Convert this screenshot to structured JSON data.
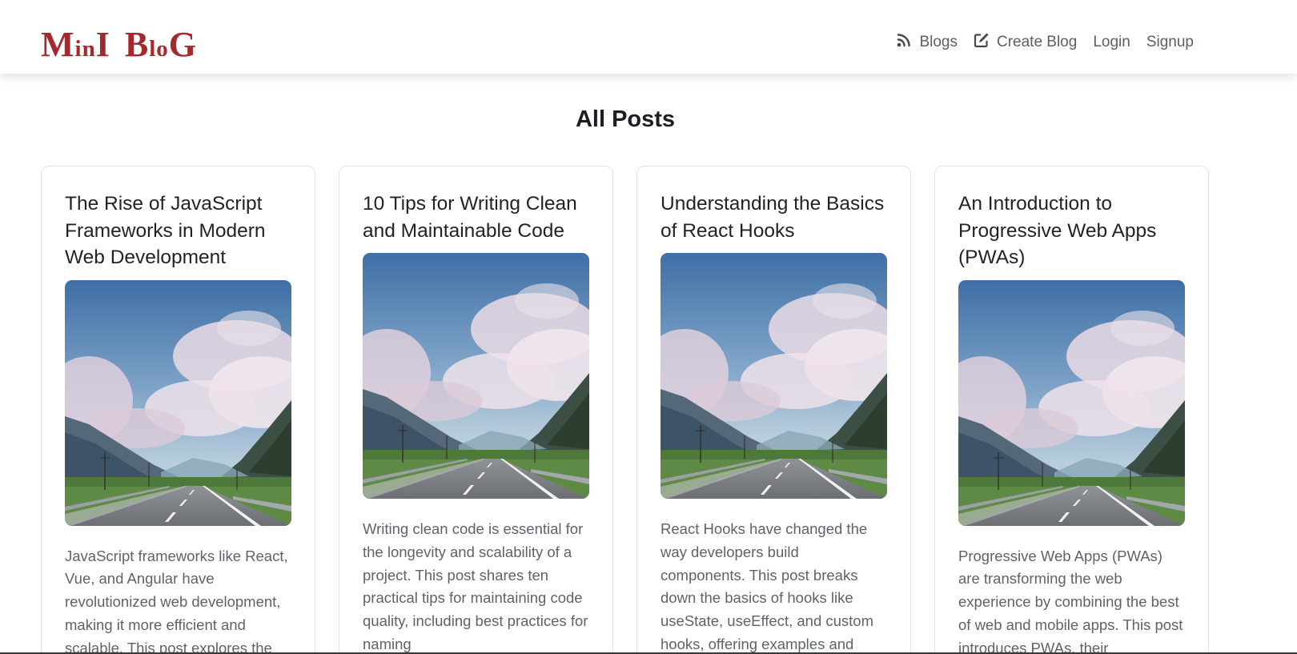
{
  "brand": {
    "logo_parts": [
      {
        "text": "M",
        "size": "big"
      },
      {
        "text": "in",
        "size": "small"
      },
      {
        "text": "I",
        "size": "big"
      },
      {
        "text": "B",
        "size": "big"
      },
      {
        "text": "lo",
        "size": "small"
      },
      {
        "text": "G",
        "size": "big"
      }
    ],
    "color": "#a4282c"
  },
  "nav": {
    "blogs_label": "Blogs",
    "blogs_icon": "rss-feed-icon",
    "create_label": "Create Blog",
    "create_icon": "edit-square-icon",
    "login_label": "Login",
    "signup_label": "Signup"
  },
  "page": {
    "title": "All Posts"
  },
  "posts": [
    {
      "title": "The Rise of JavaScript Frameworks in Modern Web Development",
      "excerpt": "JavaScript frameworks like React, Vue, and Angular have revolutionized web development, making it more efficient and scalable. This post explores the"
    },
    {
      "title": "10 Tips for Writing Clean and Maintainable Code",
      "excerpt": "Writing clean code is essential for the longevity and scalability of a project. This post shares ten practical tips for maintaining code quality, including best practices for naming"
    },
    {
      "title": "Understanding the Basics of React Hooks",
      "excerpt": "React Hooks have changed the way developers build components. This post breaks down the basics of hooks like useState, useEffect, and custom hooks, offering examples and"
    },
    {
      "title": "An Introduction to Progressive Web Apps (PWAs)",
      "excerpt": "Progressive Web Apps (PWAs) are transforming the web experience by combining the best of web and mobile apps. This post introduces PWAs, their"
    }
  ],
  "colors": {
    "accent": "#a4282c",
    "nav_text": "#5a5f66",
    "card_border": "#e2e4e8"
  }
}
